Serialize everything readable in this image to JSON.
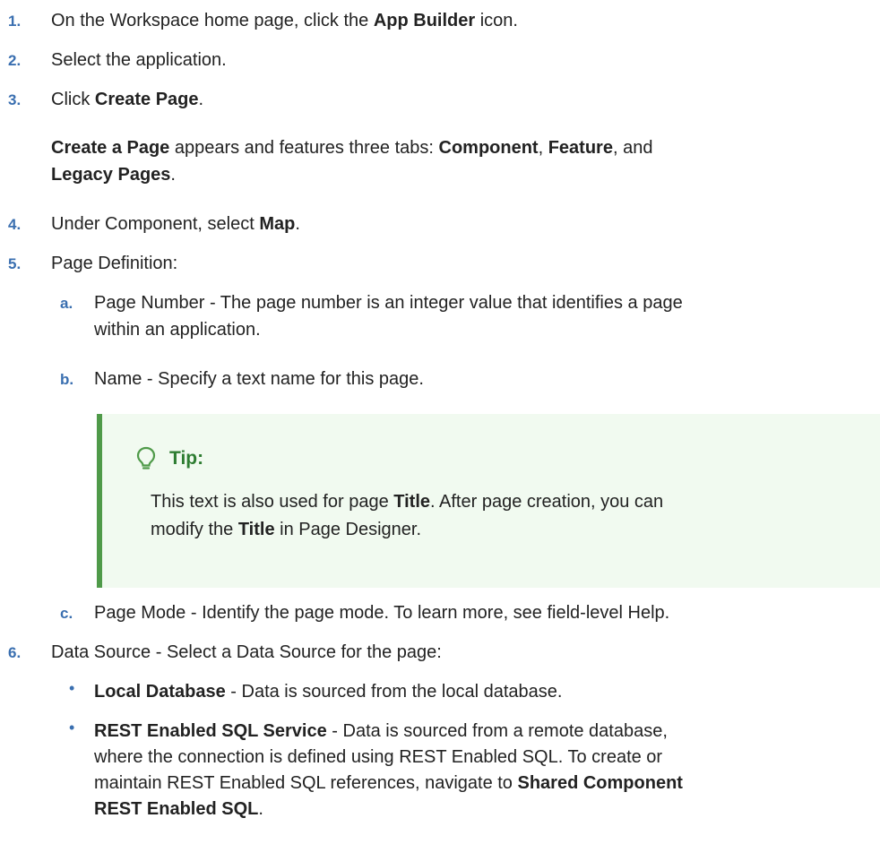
{
  "steps": [
    {
      "num": "1.",
      "pre": "On the Workspace home page, click the ",
      "bold": "App Builder",
      "post": " icon."
    },
    {
      "num": "2.",
      "text": "Select the application."
    },
    {
      "num": "3.",
      "pre": "Click ",
      "bold": "Create Page",
      "post": "."
    },
    {
      "num": "4.",
      "pre": "Under Component, select ",
      "bold": "Map",
      "post": "."
    },
    {
      "num": "5.",
      "text": "Page Definition:"
    },
    {
      "num": "6.",
      "text": "Data Source - Select a Data Source for the page:"
    }
  ],
  "create_page_para": {
    "b1": "Create a Page",
    "t1": " appears and features three tabs: ",
    "b2": "Component",
    "t2": ", ",
    "b3": "Feature",
    "t3": ", and",
    "b4": "Legacy Pages",
    "t4": "."
  },
  "substeps": [
    {
      "letter": "a.",
      "line1": "Page Number - The page number is an integer value that identifies a page",
      "line2": "within an application."
    },
    {
      "letter": "b.",
      "line1": "Name - Specify a text name for this page."
    },
    {
      "letter": "c.",
      "line1": "Page Mode - Identify the page mode. To learn more, see field-level Help."
    }
  ],
  "tip": {
    "title": "Tip:",
    "l1_pre": "This text is also used for page ",
    "l1_bold": "Title",
    "l1_post": ". After page creation, you can",
    "l2_pre": "modify the ",
    "l2_bold": "Title",
    "l2_post": " in Page Designer."
  },
  "bullets": [
    {
      "bold": "Local Database",
      "text": " - Data is sourced from the local database."
    },
    {
      "bold": "REST Enabled SQL Service",
      "text": " - Data is sourced from a remote database,",
      "line2": "where the connection is defined using REST Enabled SQL. To create or",
      "line3_pre": "maintain REST Enabled SQL references, navigate to ",
      "line3_bold": "Shared Component",
      "line4_bold": "REST Enabled SQL",
      "line4_post": "."
    }
  ],
  "bullet_char": "•",
  "colors": {
    "number": "#3a6fb0",
    "tip_accent": "#4f9a49",
    "tip_bg": "#f1faf0",
    "tip_title": "#2e7d32"
  }
}
